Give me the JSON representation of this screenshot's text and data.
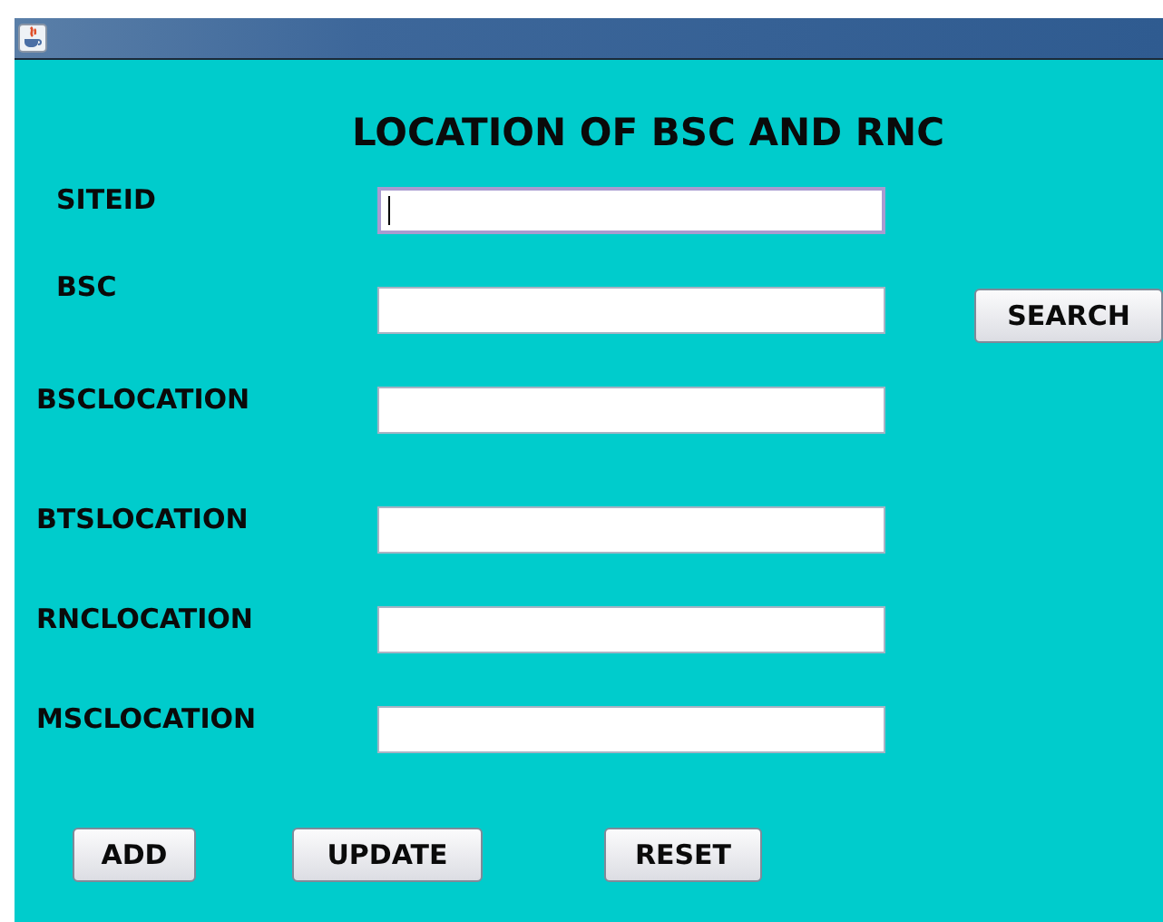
{
  "heading": "LOCATION OF BSC AND RNC",
  "fields": [
    {
      "label": "SITEID",
      "focused": true
    },
    {
      "label": "BSC",
      "focused": false
    },
    {
      "label": "BSCLOCATION",
      "focused": false
    },
    {
      "label": "BTSLOCATION",
      "focused": false
    },
    {
      "label": "RNCLOCATION",
      "focused": false
    },
    {
      "label": "MSCLOCATION",
      "focused": false
    }
  ],
  "search_button": "SEARCH",
  "buttons": [
    "ADD",
    "UPDATE",
    "RESET"
  ]
}
